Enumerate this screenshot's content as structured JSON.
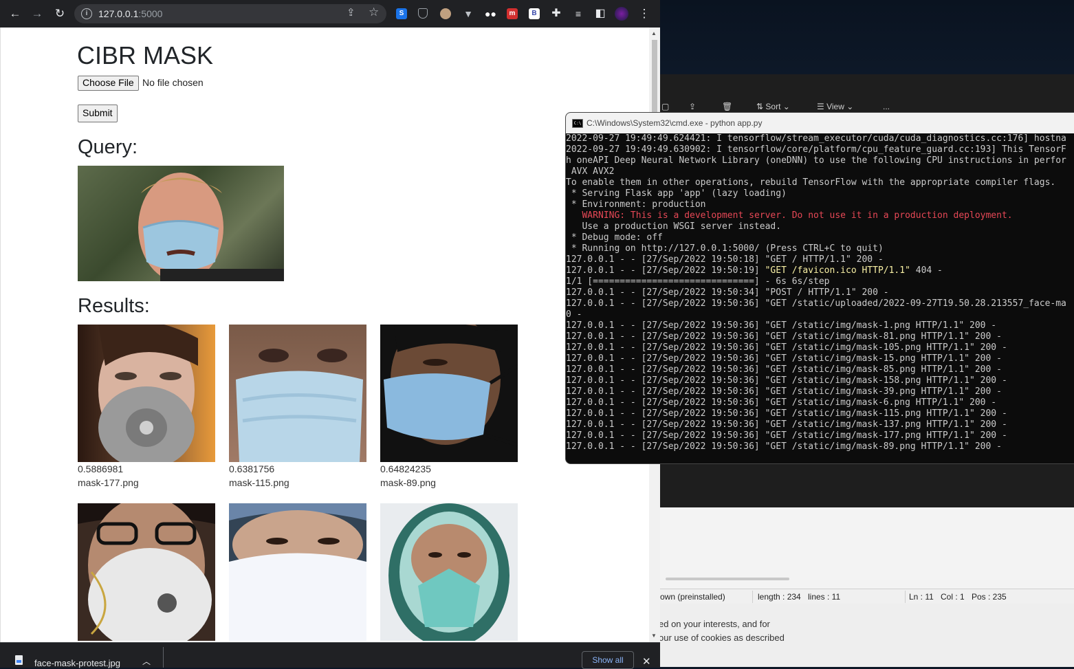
{
  "browser": {
    "url_host": "127.0.0.1",
    "url_port": ":5000",
    "icons": [
      "back-icon",
      "forward-icon",
      "reload-icon",
      "info-icon",
      "share-icon",
      "star-icon",
      "extensions-icon",
      "menu-icon"
    ]
  },
  "page": {
    "title": "CIBR MASK",
    "file_button": "Choose File",
    "file_status": "No file chosen",
    "submit": "Submit",
    "query_heading": "Query:",
    "results_heading": "Results:",
    "results": [
      {
        "score": "0.5886981",
        "file": "mask-177.png"
      },
      {
        "score": "0.6381756",
        "file": "mask-115.png"
      },
      {
        "score": "0.64824235",
        "file": "mask-89.png"
      },
      {
        "score": "",
        "file": ""
      },
      {
        "score": "",
        "file": ""
      },
      {
        "score": "",
        "file": ""
      }
    ]
  },
  "download_bar": {
    "file_name": "face-mask-protest.jpg",
    "show_all": "Show all"
  },
  "cmd": {
    "title": "C:\\Windows\\System32\\cmd.exe - python  app.py",
    "lines": [
      {
        "a": "2022-09-27 19:49:49.624421: I tensorflow/stream_executor/cuda/cuda_diagnostics.cc:176] hostna",
        "h": "",
        "b": ""
      },
      {
        "a": "2022-09-27 19:49:49.630902: I tensorflow/core/platform/cpu_feature_guard.cc:193] This TensorF",
        "h": "",
        "b": ""
      },
      {
        "a": "h oneAPI Deep Neural Network Library (oneDNN) to use the following CPU instructions in perfor",
        "h": "",
        "b": ""
      },
      {
        "a": " AVX AVX2",
        "h": "",
        "b": ""
      },
      {
        "a": "To enable them in other operations, rebuild TensorFlow with the appropriate compiler flags.",
        "h": "",
        "b": ""
      },
      {
        "a": " * Serving Flask app 'app' (lazy loading)",
        "h": "",
        "b": ""
      },
      {
        "a": " * Environment: production",
        "h": "",
        "b": ""
      },
      {
        "a": "   ",
        "h": "WARNING: This is a development server. Do not use it in a production deployment.",
        "b": ""
      },
      {
        "a": "   Use a production WSGI server instead.",
        "h": "",
        "b": ""
      },
      {
        "a": " * Debug mode: off",
        "h": "",
        "b": ""
      },
      {
        "a": " * Running on http://127.0.0.1:5000/ (Press CTRL+C to quit)",
        "h": "",
        "b": ""
      },
      {
        "a": "127.0.0.1 - - [27/Sep/2022 19:50:18] \"GET / HTTP/1.1\" 200 -",
        "h": "",
        "b": ""
      },
      {
        "a": "127.0.0.1 - - [27/Sep/2022 19:50:19] ",
        "h": "\"GET /favicon.ico HTTP/1.1\"",
        "b": " 404 -"
      },
      {
        "a": "1/1 [==============================] - 6s 6s/step",
        "h": "",
        "b": ""
      },
      {
        "a": "127.0.0.1 - - [27/Sep/2022 19:50:34] \"POST / HTTP/1.1\" 200 -",
        "h": "",
        "b": ""
      },
      {
        "a": "127.0.0.1 - - [27/Sep/2022 19:50:36] \"GET /static/uploaded/2022-09-27T19.50.28.213557_face-ma",
        "h": "",
        "b": ""
      },
      {
        "a": "0 -",
        "h": "",
        "b": ""
      },
      {
        "a": "127.0.0.1 - - [27/Sep/2022 19:50:36] \"GET /static/img/mask-1.png HTTP/1.1\" 200 -",
        "h": "",
        "b": ""
      },
      {
        "a": "127.0.0.1 - - [27/Sep/2022 19:50:36] \"GET /static/img/mask-81.png HTTP/1.1\" 200 -",
        "h": "",
        "b": ""
      },
      {
        "a": "127.0.0.1 - - [27/Sep/2022 19:50:36] \"GET /static/img/mask-105.png HTTP/1.1\" 200 -",
        "h": "",
        "b": ""
      },
      {
        "a": "127.0.0.1 - - [27/Sep/2022 19:50:36] \"GET /static/img/mask-15.png HTTP/1.1\" 200 -",
        "h": "",
        "b": ""
      },
      {
        "a": "127.0.0.1 - - [27/Sep/2022 19:50:36] \"GET /static/img/mask-85.png HTTP/1.1\" 200 -",
        "h": "",
        "b": ""
      },
      {
        "a": "127.0.0.1 - - [27/Sep/2022 19:50:36] \"GET /static/img/mask-158.png HTTP/1.1\" 200 -",
        "h": "",
        "b": ""
      },
      {
        "a": "127.0.0.1 - - [27/Sep/2022 19:50:36] \"GET /static/img/mask-39.png HTTP/1.1\" 200 -",
        "h": "",
        "b": ""
      },
      {
        "a": "127.0.0.1 - - [27/Sep/2022 19:50:36] \"GET /static/img/mask-6.png HTTP/1.1\" 200 -",
        "h": "",
        "b": ""
      },
      {
        "a": "127.0.0.1 - - [27/Sep/2022 19:50:36] \"GET /static/img/mask-115.png HTTP/1.1\" 200 -",
        "h": "",
        "b": ""
      },
      {
        "a": "127.0.0.1 - - [27/Sep/2022 19:50:36] \"GET /static/img/mask-137.png HTTP/1.1\" 200 -",
        "h": "",
        "b": ""
      },
      {
        "a": "127.0.0.1 - - [27/Sep/2022 19:50:36] \"GET /static/img/mask-177.png HTTP/1.1\" 200 -",
        "h": "",
        "b": ""
      },
      {
        "a": "127.0.0.1 - - [27/Sep/2022 19:50:36] \"GET /static/img/mask-89.png HTTP/1.1\" 200 -",
        "h": "",
        "b": ""
      }
    ]
  },
  "explorer": {
    "sort_label": "Sort",
    "view_label": "View",
    "more_label": "..."
  },
  "status_bar": {
    "language": "own (preinstalled)",
    "length": "length : 234",
    "lines": "lines : 11",
    "ln": "Ln : 11",
    "col": "Col : 1",
    "pos": "Pos : 235"
  },
  "cookie_text": {
    "line1": "ed on your interests, and for",
    "line2": "our use of cookies as described"
  },
  "colors": {
    "browser_toolbar": "#202124",
    "cmd_background": "#0c0c0c",
    "warning_red": "#e74856",
    "highlight_yellow": "#f9f1a5"
  }
}
